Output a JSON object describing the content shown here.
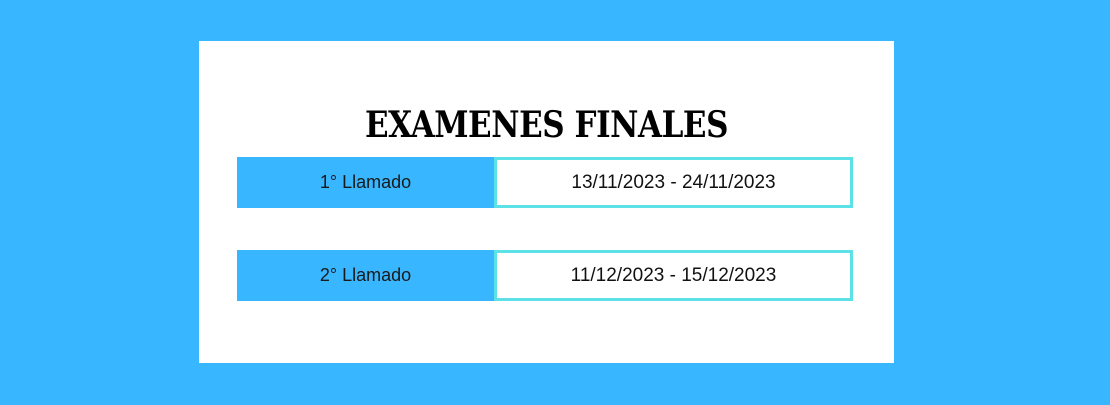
{
  "title": "EXAMENES FINALES",
  "calls": [
    {
      "label": "1° Llamado",
      "dates": "13/11/2023 - 24/11/2023"
    },
    {
      "label": "2° Llamado",
      "dates": "11/12/2023 - 15/12/2023"
    }
  ],
  "colors": {
    "background": "#38b6ff",
    "card": "#ffffff",
    "label_cell": "#38b6ff",
    "date_border": "#5ce1e6"
  }
}
